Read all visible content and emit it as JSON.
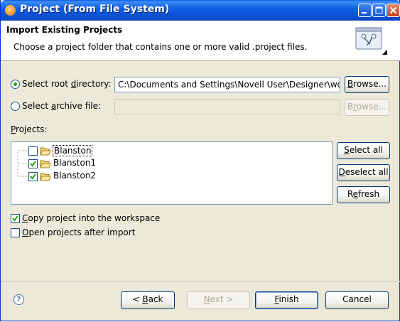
{
  "window": {
    "title": "Project (From File System)",
    "app_icon": "wizard-icon",
    "controls": [
      "minimize-icon",
      "maximize-icon",
      "close-icon"
    ]
  },
  "header": {
    "title": "Import Existing Projects",
    "description": "Choose a project folder that contains one or more valid .project files.",
    "graphic": "import-wizard-graphic"
  },
  "source": {
    "root_label": "Select root directory:",
    "root_selected": true,
    "root_path": "C:\\Documents and Settings\\Novell User\\Designer\\wo",
    "root_browse": "Browse...",
    "archive_label": "Select archive file:",
    "archive_selected": false,
    "archive_path": "",
    "archive_browse": "Browse..."
  },
  "projects": {
    "label": "Projects:",
    "items": [
      {
        "name": "Blanston",
        "checked": false
      },
      {
        "name": "Blanston1",
        "checked": true
      },
      {
        "name": "Blanston2",
        "checked": true
      }
    ],
    "select_all": "Select all",
    "deselect_all": "Deselect all",
    "refresh": "Refresh"
  },
  "options": {
    "copy_label": "Copy project into the workspace",
    "copy_checked": true,
    "open_label": "Open projects after import",
    "open_checked": false
  },
  "footer": {
    "help_icon": "help-icon",
    "back": "< Back",
    "next": "Next >",
    "finish": "Finish",
    "cancel": "Cancel"
  },
  "colors": {
    "titlebar": "#0a53d8",
    "dialog_bg": "#ece9d8",
    "check_green": "#21a121"
  }
}
